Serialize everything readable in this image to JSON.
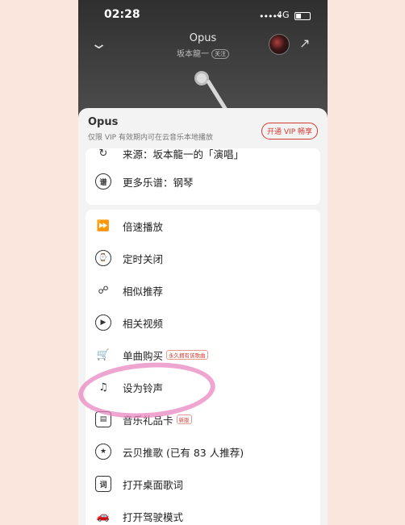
{
  "status_bar": {
    "time": "02:28",
    "signal": "•••••",
    "network": "4G"
  },
  "player": {
    "song_title": "Opus",
    "artist": "坂本龍一",
    "follow_label": "关注"
  },
  "sheet": {
    "title": "Opus",
    "subtitle": "仅限 VIP 有效期内可在云音乐本地播放",
    "vip_button": "开通 VIP 畅享"
  },
  "menu_top": [
    {
      "icon": "source-icon",
      "label": "来源：坂本龍一的「演唱」"
    },
    {
      "icon": "sheet-music-icon",
      "label": "更多乐谱：钢琴"
    }
  ],
  "menu_main": [
    {
      "icon": "speed-icon",
      "label": "倍速播放",
      "tag": ""
    },
    {
      "icon": "timer-icon",
      "label": "定时关闭",
      "tag": ""
    },
    {
      "icon": "similar-icon",
      "label": "相似推荐",
      "tag": ""
    },
    {
      "icon": "video-icon",
      "label": "相关视频",
      "tag": ""
    },
    {
      "icon": "cart-icon",
      "label": "单曲购买",
      "tag": "永久拥有该歌曲"
    },
    {
      "icon": "ringtone-icon",
      "label": "设为铃声",
      "tag": ""
    },
    {
      "icon": "card-icon",
      "label": "音乐礼品卡",
      "tag": "新版"
    },
    {
      "icon": "recommend-icon",
      "label": "云贝推歌 (已有 83 人推荐)",
      "tag": ""
    },
    {
      "icon": "lyrics-icon",
      "label": "打开桌面歌词",
      "tag": ""
    },
    {
      "icon": "car-icon",
      "label": "打开驾驶模式",
      "tag": ""
    }
  ],
  "annotation_color": "#e882be"
}
